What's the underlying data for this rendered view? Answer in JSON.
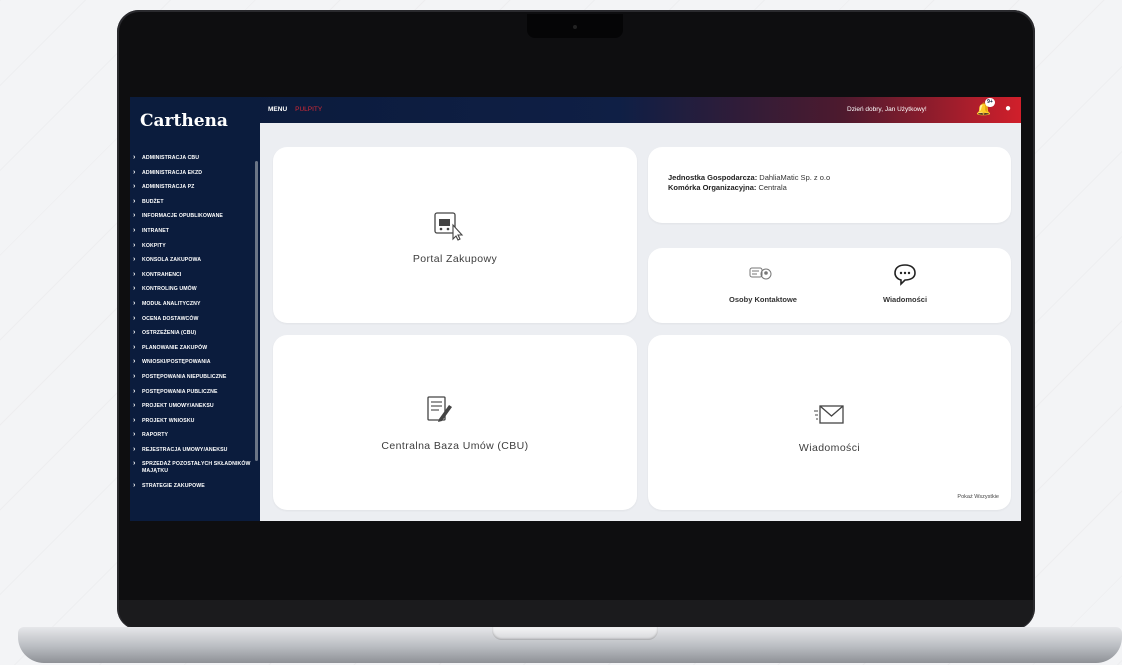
{
  "app": {
    "logo": "Carthena",
    "menu_tabs": [
      "MENU",
      "PULPITY"
    ],
    "greeting": "Dzień dobry, Jan Użytkowy!",
    "notification_badge": "9+"
  },
  "sidebar": {
    "items": [
      "ADMINISTRACJA CBU",
      "ADMINISTRACJA EKZD",
      "ADMINISTRACJA PZ",
      "BUDŻET",
      "INFORMACJE OPUBLIKOWANE",
      "INTRANET",
      "KOKPITY",
      "KONSOLA ZAKUPOWA",
      "KONTRAHENCI",
      "KONTROLING UMÓW",
      "MODUŁ ANALITYCZNY",
      "OCENA DOSTAWCÓW",
      "OSTRZEŻENIA (CBU)",
      "PLANOWANIE ZAKUPÓW",
      "WNIOSKI/POSTĘPOWANIA",
      "POSTĘPOWANIA NIEPUBLICZNE",
      "POSTĘPOWANIA PUBLICZNE",
      "PROJEKT UMOWY/ANEKSU",
      "PROJEKT WNIOSKU",
      "RAPORTY",
      "REJESTRACJA UMOWY/ANEKSU",
      "SPRZEDAŻ POZOSTAŁYCH SKŁADNIKÓW MAJĄTKU",
      "STRATEGIE ZAKUPOWE"
    ]
  },
  "tiles": {
    "portal": "Portal Zakupowy",
    "cbu": "Centralna Baza Umów (CBU)",
    "messages": "Wiadomości",
    "show_all": "Pokaż Wszystkie"
  },
  "info": {
    "unit_label": "Jednostka Gospodarcza:",
    "unit_value": "DahliaMatic Sp. z o.o",
    "org_label": "Komórka Organizacyjna:",
    "org_value": "Centrala"
  },
  "contacts": {
    "contacts_label": "Osoby Kontaktowe",
    "messages_label": "Wiadomości"
  },
  "colors": {
    "sidebar_bg": "#0b1c3d",
    "accent_red": "#d11f2b"
  }
}
